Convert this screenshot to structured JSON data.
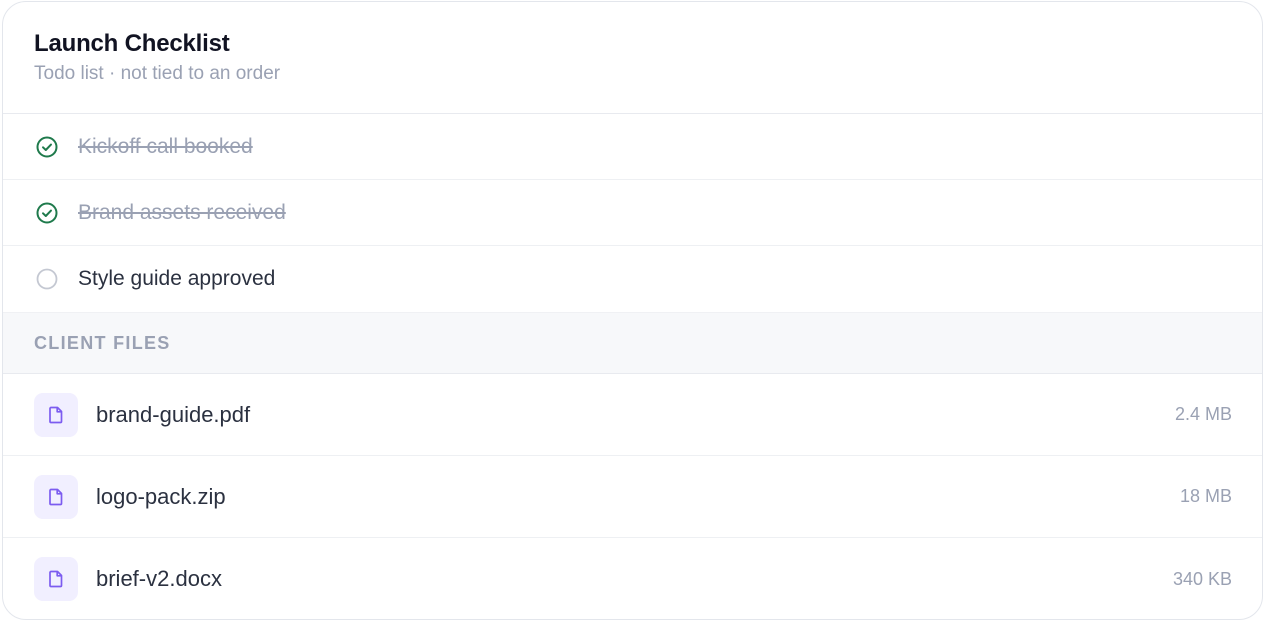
{
  "checklist": {
    "title": "Launch Checklist",
    "subtitle": "Todo list · not tied to an order",
    "items": [
      {
        "label": "Kickoff call booked",
        "done": true
      },
      {
        "label": "Brand assets received",
        "done": true
      },
      {
        "label": "Style guide approved",
        "done": false
      }
    ]
  },
  "files": {
    "section_title": "CLIENT FILES",
    "items": [
      {
        "name": "brand-guide.pdf",
        "size": "2.4 MB",
        "icon": "file-icon"
      },
      {
        "name": "logo-pack.zip",
        "size": "18 MB",
        "icon": "file-icon"
      },
      {
        "name": "brief-v2.docx",
        "size": "340 KB",
        "icon": "file-icon"
      }
    ]
  },
  "colors": {
    "done_check": "#1f7a4c",
    "pending_circle": "#c4c8d2",
    "file_icon_accent": "#7c5cf0",
    "file_icon_bg": "#f1efff",
    "muted_text": "#9aa1b3",
    "title_text": "#111322"
  }
}
